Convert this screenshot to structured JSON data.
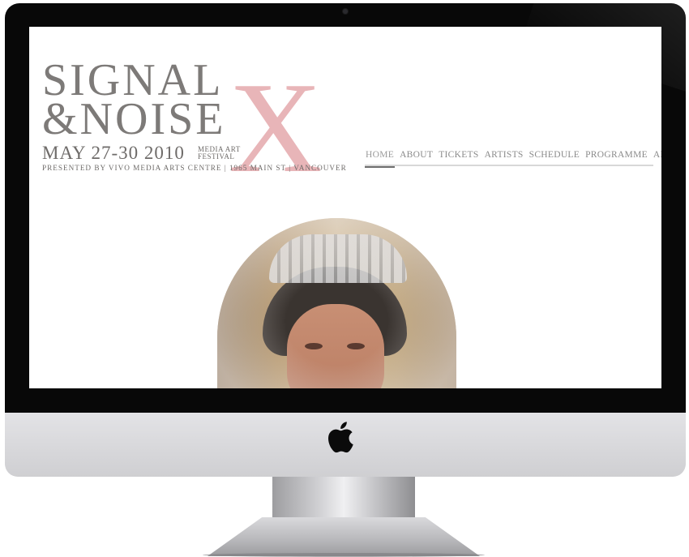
{
  "site": {
    "logo": {
      "line1": "SIGNAL",
      "line2": "&NOISE",
      "big_x": "X",
      "dates": "MAY 27-30 2010",
      "media": "MEDIA ART",
      "festival": "FESTIVAL",
      "presented": "PRESENTED BY VIVO MEDIA ARTS CENTRE | 1965 MAIN ST | VANCOUVER"
    },
    "nav": {
      "items": [
        {
          "label": "HOME",
          "active": true
        },
        {
          "label": "ABOUT"
        },
        {
          "label": "TICKETS"
        },
        {
          "label": "ARTISTS"
        },
        {
          "label": "SCHEDULE"
        },
        {
          "label": "PROGRAMME"
        },
        {
          "label": "ARCHIVE"
        }
      ]
    },
    "colors": {
      "logo_gray": "#7d7a78",
      "accent_pink": "#e8b5b8",
      "nav_text": "#8a8a8a",
      "nav_active_underline": "#6e6e6e"
    }
  },
  "device": {
    "type": "imac",
    "logo_icon": "apple-logo-icon"
  }
}
